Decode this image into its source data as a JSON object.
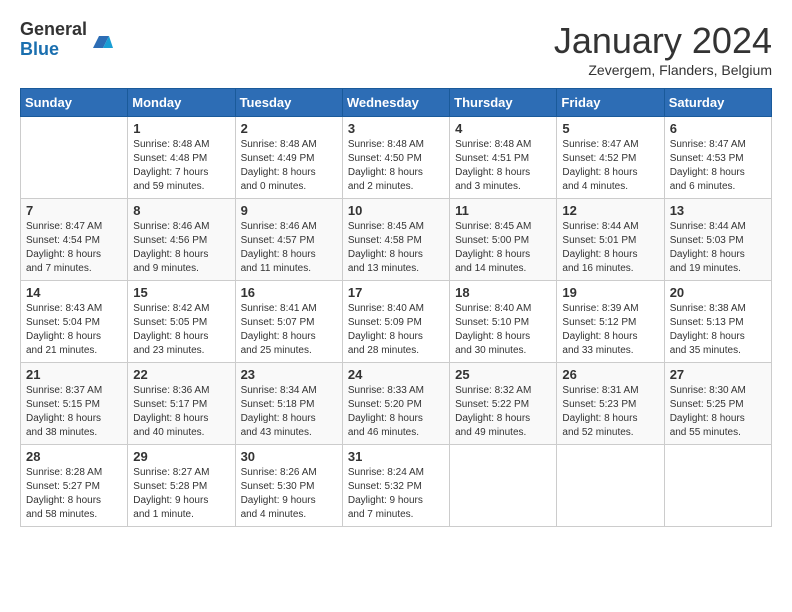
{
  "logo": {
    "general": "General",
    "blue": "Blue"
  },
  "title": "January 2024",
  "subtitle": "Zevergem, Flanders, Belgium",
  "days_of_week": [
    "Sunday",
    "Monday",
    "Tuesday",
    "Wednesday",
    "Thursday",
    "Friday",
    "Saturday"
  ],
  "weeks": [
    [
      {
        "day": "",
        "info": ""
      },
      {
        "day": "1",
        "info": "Sunrise: 8:48 AM\nSunset: 4:48 PM\nDaylight: 7 hours\nand 59 minutes."
      },
      {
        "day": "2",
        "info": "Sunrise: 8:48 AM\nSunset: 4:49 PM\nDaylight: 8 hours\nand 0 minutes."
      },
      {
        "day": "3",
        "info": "Sunrise: 8:48 AM\nSunset: 4:50 PM\nDaylight: 8 hours\nand 2 minutes."
      },
      {
        "day": "4",
        "info": "Sunrise: 8:48 AM\nSunset: 4:51 PM\nDaylight: 8 hours\nand 3 minutes."
      },
      {
        "day": "5",
        "info": "Sunrise: 8:47 AM\nSunset: 4:52 PM\nDaylight: 8 hours\nand 4 minutes."
      },
      {
        "day": "6",
        "info": "Sunrise: 8:47 AM\nSunset: 4:53 PM\nDaylight: 8 hours\nand 6 minutes."
      }
    ],
    [
      {
        "day": "7",
        "info": "Sunrise: 8:47 AM\nSunset: 4:54 PM\nDaylight: 8 hours\nand 7 minutes."
      },
      {
        "day": "8",
        "info": "Sunrise: 8:46 AM\nSunset: 4:56 PM\nDaylight: 8 hours\nand 9 minutes."
      },
      {
        "day": "9",
        "info": "Sunrise: 8:46 AM\nSunset: 4:57 PM\nDaylight: 8 hours\nand 11 minutes."
      },
      {
        "day": "10",
        "info": "Sunrise: 8:45 AM\nSunset: 4:58 PM\nDaylight: 8 hours\nand 13 minutes."
      },
      {
        "day": "11",
        "info": "Sunrise: 8:45 AM\nSunset: 5:00 PM\nDaylight: 8 hours\nand 14 minutes."
      },
      {
        "day": "12",
        "info": "Sunrise: 8:44 AM\nSunset: 5:01 PM\nDaylight: 8 hours\nand 16 minutes."
      },
      {
        "day": "13",
        "info": "Sunrise: 8:44 AM\nSunset: 5:03 PM\nDaylight: 8 hours\nand 19 minutes."
      }
    ],
    [
      {
        "day": "14",
        "info": "Sunrise: 8:43 AM\nSunset: 5:04 PM\nDaylight: 8 hours\nand 21 minutes."
      },
      {
        "day": "15",
        "info": "Sunrise: 8:42 AM\nSunset: 5:05 PM\nDaylight: 8 hours\nand 23 minutes."
      },
      {
        "day": "16",
        "info": "Sunrise: 8:41 AM\nSunset: 5:07 PM\nDaylight: 8 hours\nand 25 minutes."
      },
      {
        "day": "17",
        "info": "Sunrise: 8:40 AM\nSunset: 5:09 PM\nDaylight: 8 hours\nand 28 minutes."
      },
      {
        "day": "18",
        "info": "Sunrise: 8:40 AM\nSunset: 5:10 PM\nDaylight: 8 hours\nand 30 minutes."
      },
      {
        "day": "19",
        "info": "Sunrise: 8:39 AM\nSunset: 5:12 PM\nDaylight: 8 hours\nand 33 minutes."
      },
      {
        "day": "20",
        "info": "Sunrise: 8:38 AM\nSunset: 5:13 PM\nDaylight: 8 hours\nand 35 minutes."
      }
    ],
    [
      {
        "day": "21",
        "info": "Sunrise: 8:37 AM\nSunset: 5:15 PM\nDaylight: 8 hours\nand 38 minutes."
      },
      {
        "day": "22",
        "info": "Sunrise: 8:36 AM\nSunset: 5:17 PM\nDaylight: 8 hours\nand 40 minutes."
      },
      {
        "day": "23",
        "info": "Sunrise: 8:34 AM\nSunset: 5:18 PM\nDaylight: 8 hours\nand 43 minutes."
      },
      {
        "day": "24",
        "info": "Sunrise: 8:33 AM\nSunset: 5:20 PM\nDaylight: 8 hours\nand 46 minutes."
      },
      {
        "day": "25",
        "info": "Sunrise: 8:32 AM\nSunset: 5:22 PM\nDaylight: 8 hours\nand 49 minutes."
      },
      {
        "day": "26",
        "info": "Sunrise: 8:31 AM\nSunset: 5:23 PM\nDaylight: 8 hours\nand 52 minutes."
      },
      {
        "day": "27",
        "info": "Sunrise: 8:30 AM\nSunset: 5:25 PM\nDaylight: 8 hours\nand 55 minutes."
      }
    ],
    [
      {
        "day": "28",
        "info": "Sunrise: 8:28 AM\nSunset: 5:27 PM\nDaylight: 8 hours\nand 58 minutes."
      },
      {
        "day": "29",
        "info": "Sunrise: 8:27 AM\nSunset: 5:28 PM\nDaylight: 9 hours\nand 1 minute."
      },
      {
        "day": "30",
        "info": "Sunrise: 8:26 AM\nSunset: 5:30 PM\nDaylight: 9 hours\nand 4 minutes."
      },
      {
        "day": "31",
        "info": "Sunrise: 8:24 AM\nSunset: 5:32 PM\nDaylight: 9 hours\nand 7 minutes."
      },
      {
        "day": "",
        "info": ""
      },
      {
        "day": "",
        "info": ""
      },
      {
        "day": "",
        "info": ""
      }
    ]
  ],
  "colors": {
    "header_bg": "#2d6db5",
    "header_text": "#ffffff",
    "border": "#cccccc"
  }
}
